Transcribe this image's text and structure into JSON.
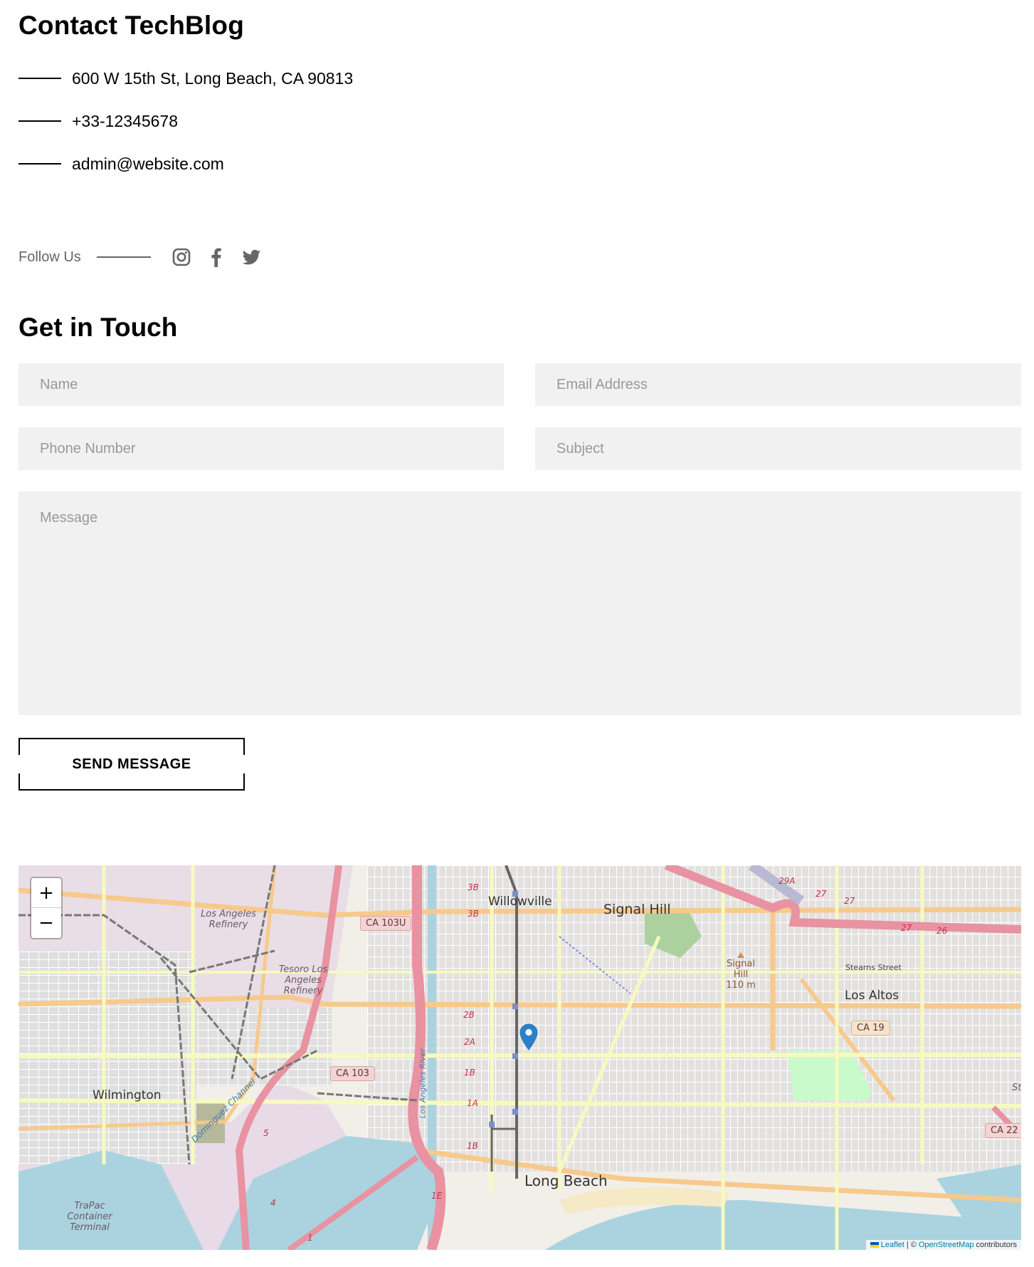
{
  "contact": {
    "title": "Contact TechBlog",
    "items": [
      {
        "type": "address",
        "text": "600 W 15th St, Long Beach, CA 90813"
      },
      {
        "type": "phone",
        "text": "+33-12345678"
      },
      {
        "type": "email",
        "text": "admin@website.com"
      }
    ]
  },
  "follow": {
    "label": "Follow Us",
    "icons": [
      "instagram-icon",
      "facebook-icon",
      "twitter-icon"
    ]
  },
  "form": {
    "title": "Get in Touch",
    "name_placeholder": "Name",
    "email_placeholder": "Email Address",
    "phone_placeholder": "Phone Number",
    "subject_placeholder": "Subject",
    "message_placeholder": "Message",
    "name_value": "",
    "email_value": "",
    "phone_value": "",
    "subject_value": "",
    "message_value": "",
    "submit_label": "SEND MESSAGE"
  },
  "map": {
    "zoom_in_label": "+",
    "zoom_out_label": "−",
    "places": {
      "willowville": "Willowville",
      "signal_hill": "Signal Hill",
      "los_altos": "Los Altos",
      "wilmington": "Wilmington",
      "long_beach": "Long Beach"
    },
    "industrial": {
      "la_refinery": "Los Angeles Refinery",
      "tesoro": "Tesoro Los Angeles Refinery",
      "trapac": "TraPac Container Terminal"
    },
    "peak": {
      "name": "Signal Hill",
      "elevation": "110 m"
    },
    "streets": {
      "stearns": "Stearns Street",
      "dominguez": "Dominguez Channel",
      "la_river": "Los Angeles River"
    },
    "shields": {
      "ca103u": "CA 103U",
      "ca103": "CA 103",
      "ca19": "CA 19",
      "ca22": "CA 22"
    },
    "exits": [
      "3B",
      "3B",
      "2B",
      "2A",
      "1B",
      "1A",
      "1B",
      "1E",
      "29A",
      "27",
      "27",
      "27",
      "26",
      "5",
      "4",
      "1"
    ],
    "partial_label": "Sta",
    "attribution": {
      "leaflet": "Leaflet",
      "separator": "| ©",
      "osm": "OpenStreetMap",
      "suffix": "contributors"
    }
  },
  "colors": {
    "field_bg": "#f1f1f1",
    "placeholder": "#999999",
    "muted": "#666666",
    "marker": "#2a81cb",
    "link": "#0078a8"
  }
}
